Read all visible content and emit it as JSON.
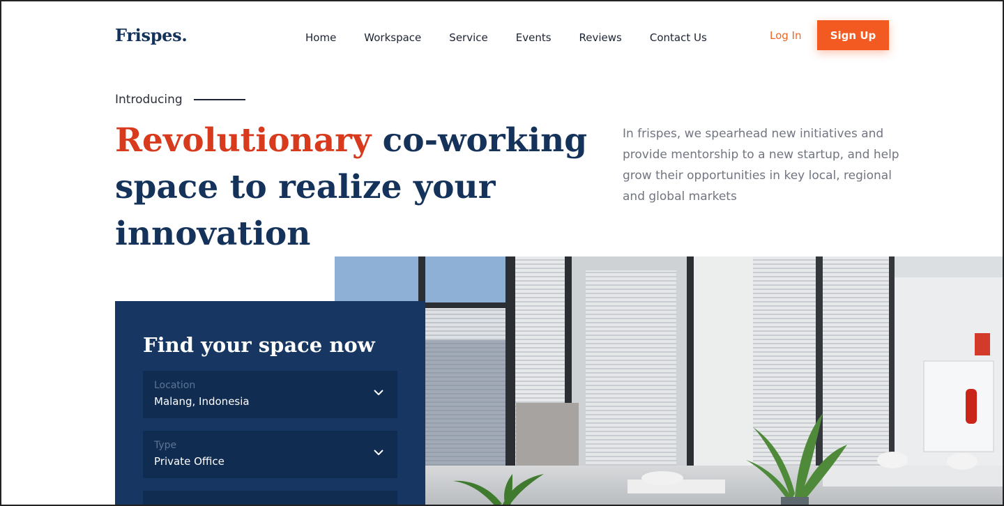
{
  "brand": {
    "logo_text": "Frispes."
  },
  "nav": {
    "items": [
      {
        "label": "Home"
      },
      {
        "label": "Workspace"
      },
      {
        "label": "Service"
      },
      {
        "label": "Events"
      },
      {
        "label": "Reviews"
      },
      {
        "label": "Contact Us"
      }
    ]
  },
  "auth": {
    "login_label": "Log In",
    "signup_label": "Sign Up"
  },
  "hero": {
    "intro": "Introducing",
    "headline_accent": "Revolutionary",
    "headline_rest": " co-working space to realize your innovation",
    "description": "In frispes, we spearhead new initiatives and provide mentorship to a new startup, and help grow their opportunities in key local, regional and global markets"
  },
  "search": {
    "title": "Find your space now",
    "fields": [
      {
        "label": "Location",
        "value": "Malang, Indonesia",
        "icon": "chevron-down-icon"
      },
      {
        "label": "Type",
        "value": "Private Office",
        "icon": "chevron-down-icon"
      }
    ]
  },
  "colors": {
    "brand_navy": "#14325a",
    "accent_orange": "#f25a22",
    "headline_red": "#d73a1c",
    "card_bg": "#173762",
    "field_bg": "#112c51"
  }
}
